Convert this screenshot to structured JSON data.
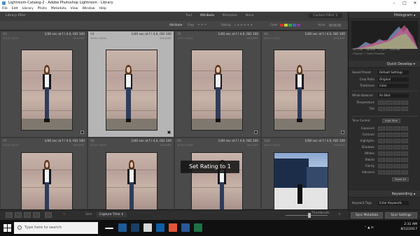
{
  "window": {
    "title": "Lightroom-Catalog-2 - Adobe Photoshop Lightroom - Library"
  },
  "menu": [
    "File",
    "Edit",
    "Library",
    "Photo",
    "Metadata",
    "View",
    "Window",
    "Help"
  ],
  "filter": {
    "title": "Library Filter :",
    "tabs": [
      "Text",
      "Attribute",
      "Metadata",
      "None"
    ],
    "active_tab": "Attribute",
    "preset": "Custom Filter ↕",
    "row_attribute": "Attribute",
    "row_flag": "Flag",
    "row_rating": "Rating",
    "row_color": "Color",
    "row_kind": "Kind"
  },
  "grid": {
    "cells": [
      {
        "num": "93",
        "info": "1/40 sec at f / 4.0, ISO 100",
        "dims": "4016 x 6016",
        "ftype": "DNG/NEF"
      },
      {
        "num": "94",
        "info": "1/40 sec at f / 4.0, ISO 100",
        "dims": "4016 x 6016",
        "ftype": "DNG/NEF"
      },
      {
        "num": "95",
        "info": "1/40 sec at f / 4.0, ISO 100",
        "dims": "4016 x 6016",
        "ftype": "DNG/NEF"
      },
      {
        "num": "96",
        "info": "1/40 sec at f / 4.0, ISO 100",
        "dims": "4016 x 6016",
        "ftype": "DNG/NEF"
      },
      {
        "num": "97",
        "info": "1/40 sec at f / 4.0, ISO 100",
        "dims": "4016 x 6016",
        "ftype": "DNG/NEF"
      },
      {
        "num": "98",
        "info": "1/40 sec at f / 4.0, ISO 100",
        "dims": "4016 x 6016",
        "ftype": "DNG/NEF"
      },
      {
        "num": "99",
        "info": "1/40 sec at f / 4.0, ISO 100",
        "dims": "4016 x 6016",
        "ftype": "DNG/NEF"
      },
      {
        "num": "100",
        "info": "1/40 sec at f / 4.0, ISO 100",
        "dims": "4016 x 6016",
        "ftype": "DNG/NEF"
      }
    ],
    "selected_index": 1
  },
  "overlay": {
    "text": "Set Rating to 1"
  },
  "toolbar": {
    "sort_label": "Sort:",
    "sort_value": "Capture Time ↕",
    "thumbnails_label": "Thumbnails"
  },
  "panel": {
    "histogram_title": "Histogram ◂",
    "histogram_values": [
      "ISO 100",
      "48 mm",
      "f / 4.0",
      "1/40 sec"
    ],
    "histogram_sub": "Original + Smart Preview",
    "quick_develop_title": "Quick Develop ▾",
    "saved_preset_label": "Saved Preset",
    "saved_preset_value": "Default Settings",
    "crop_ratio_label": "Crop Ratio",
    "crop_ratio_value": "Original",
    "treatment_label": "Treatment",
    "treatment_value": "Color",
    "white_balance_label": "White Balance",
    "white_balance_value": "As Shot",
    "temperature_label": "Temperature",
    "tint_label": "Tint",
    "tone_control_label": "Tone Control",
    "auto_tone_label": "Auto Tone",
    "exposure_label": "Exposure",
    "contrast_label": "Contrast",
    "highlights_label": "Highlights",
    "shadows_label": "Shadows",
    "whites_label": "Whites",
    "blacks_label": "Blacks",
    "clarity_label": "Clarity",
    "vibrance_label": "Vibrance",
    "reset_all_label": "Reset All",
    "keywording_title": "Keywording ◂",
    "keyword_tags_label": "Keyword Tags",
    "keyword_tags_value": "Enter Keywords",
    "sync_metadata_label": "Sync Metadata",
    "sync_settings_label": "Sync Settings"
  },
  "taskbar": {
    "search_placeholder": "Type here to search",
    "time": "2:31 AM",
    "date": "8/12/2017"
  },
  "colors": {
    "selected_cell": "#b5b5b5",
    "grid_bg": "#4a4a4a",
    "panel_bg": "#2b2b2b"
  }
}
